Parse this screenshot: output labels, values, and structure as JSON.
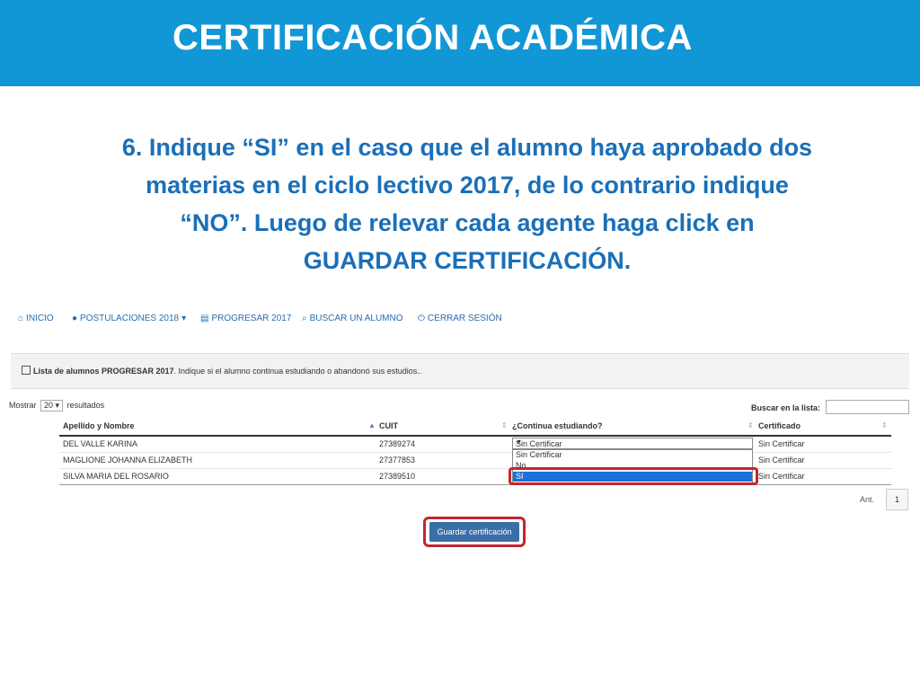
{
  "slide": {
    "title": "CERTIFICACIÓN ACADÉMICA",
    "instruction_lines": [
      "6. Indique “SI” en el caso que el alumno haya aprobado dos",
      "materias en el ciclo lectivo 2017, de lo contrario indique",
      "“NO”. Luego de relevar cada agente haga click en",
      "GUARDAR CERTIFICACIÓN."
    ]
  },
  "nav": {
    "items": [
      {
        "icon": "home-icon",
        "label": "INICIO"
      },
      {
        "icon": "info-icon",
        "label": "POSTULACIONES 2018",
        "caret": "▾"
      },
      {
        "icon": "document-icon",
        "label": "PROGRESAR 2017"
      },
      {
        "icon": "search-icon",
        "label": "BUSCAR UN ALUMNO"
      },
      {
        "icon": "power-icon",
        "label": "CERRAR SESIÓN"
      }
    ]
  },
  "panel": {
    "title_bold": "Lista de alumnos PROGRESAR 2017",
    "title_rest": ". Indique si el alumno continua estudiando o abandonó sus estudios.."
  },
  "controls": {
    "show_label": "Mostrar",
    "show_value": "20",
    "results_label": "resultados",
    "search_label": "Buscar en la lista:",
    "search_value": ""
  },
  "table": {
    "headers": [
      "Apellido y Nombre",
      "CUIT",
      "¿Continua estudiando?",
      "Certificado"
    ],
    "rows": [
      {
        "name": "DEL VALLE KARINA",
        "cuit": "27389274",
        "estado": "Sin Certificar",
        "certificado": "Sin Certificar"
      },
      {
        "name": "MAGLIONE JOHANNA ELIZABETH",
        "cuit": "27377853",
        "estado": "",
        "certificado": "Sin Certificar"
      },
      {
        "name": "SILVA MARIA DEL ROSARIO",
        "cuit": "27389510",
        "estado": "",
        "certificado": "Sin Certificar"
      }
    ]
  },
  "dropdown": {
    "selected": "Sin Certificar",
    "options": [
      "Sin Certificar",
      "No",
      "SI"
    ],
    "highlighted": "SI"
  },
  "pagination": {
    "prev_label": "Ant.",
    "page": "1"
  },
  "save_button": {
    "label": "Guardar certificación"
  },
  "colors": {
    "banner": "#1197d6",
    "instruction": "#1a6fb8",
    "highlight": "#c1272d",
    "button": "#3a6ea8"
  }
}
